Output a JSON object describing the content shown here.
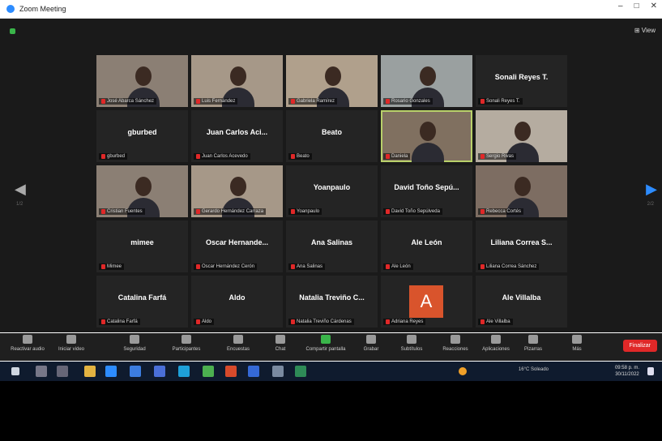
{
  "window": {
    "title": "Zoom Meeting",
    "controls": [
      "–",
      "□",
      "✕"
    ]
  },
  "view_button": "⊞ View",
  "pages": {
    "left": "1/2",
    "right": "2/2"
  },
  "participants": [
    {
      "label": "José Abarca Sánchez",
      "type": "video"
    },
    {
      "label": "Luis Fernández",
      "type": "video"
    },
    {
      "label": "Gabriela Ramírez",
      "type": "video"
    },
    {
      "label": "Rosario Gonzales",
      "type": "video"
    },
    {
      "name": "Sonali Reyes T.",
      "label": "Sonali Reyes T.",
      "type": "name"
    },
    {
      "name": "gburbed",
      "label": "gburbed",
      "type": "name"
    },
    {
      "name": "Juan Carlos Aci...",
      "label": "Juan Carlos Acevedo",
      "type": "name"
    },
    {
      "name": "Beato",
      "label": "Beato",
      "type": "name"
    },
    {
      "label": "Daniela",
      "type": "video",
      "active": true
    },
    {
      "label": "Sergio Rivas",
      "type": "video"
    },
    {
      "label": "Cristian Fuentes",
      "type": "video"
    },
    {
      "label": "Gerardo Hernández Carraza",
      "type": "video"
    },
    {
      "name": "Yoanpaulo",
      "label": "Yoanpaulo",
      "type": "name"
    },
    {
      "name": "David Toño Sepú...",
      "label": "David Toño Sepúlveda",
      "type": "name"
    },
    {
      "label": "Rebecca Cortés",
      "type": "video"
    },
    {
      "name": "mimee",
      "label": "Mimee",
      "type": "name"
    },
    {
      "name": "Oscar Hernande...",
      "label": "Oscar Hernández Cerón",
      "type": "name"
    },
    {
      "name": "Ana Salinas",
      "label": "Ana Salinas",
      "type": "name"
    },
    {
      "name": "Ale León",
      "label": "Ale León",
      "type": "name"
    },
    {
      "name": "Liliana Correa S...",
      "label": "Liliana Correa Sánchez",
      "type": "name"
    },
    {
      "name": "Catalina Farfá",
      "label": "Catalina Farfá",
      "type": "name"
    },
    {
      "name": "Aldo",
      "label": "Aldo",
      "type": "name"
    },
    {
      "name": "Natalia Treviño C...",
      "label": "Natalia Treviño Cárdenas",
      "type": "name"
    },
    {
      "initial": "A",
      "label": "Adriana Reyes",
      "type": "avatar"
    },
    {
      "name": "Ale Villalba",
      "label": "Ale Villalba",
      "type": "name"
    }
  ],
  "toolbar": [
    {
      "label": "Reactivar audio",
      "icon": "mic-icon"
    },
    {
      "label": "Iniciar video",
      "icon": "camera-icon"
    },
    {
      "label": "Seguridad",
      "icon": "shield-icon"
    },
    {
      "label": "Participantes",
      "icon": "participants-icon"
    },
    {
      "label": "Encuestas",
      "icon": "poll-icon"
    },
    {
      "label": "Chat",
      "icon": "chat-icon"
    },
    {
      "label": "Compartir pantalla",
      "icon": "share-icon"
    },
    {
      "label": "Grabar",
      "icon": "record-icon"
    },
    {
      "label": "Subtítulos",
      "icon": "cc-icon"
    },
    {
      "label": "Reacciones",
      "icon": "reaction-icon"
    },
    {
      "label": "Aplicaciones",
      "icon": "apps-icon"
    },
    {
      "label": "Pizarras",
      "icon": "whiteboard-icon"
    },
    {
      "label": "Más",
      "icon": "more-icon"
    }
  ],
  "end_button": "Finalizar",
  "taskbar": {
    "weather": "16°C Soleado",
    "time": "09:58 p. m.",
    "date": "30/11/2022"
  }
}
